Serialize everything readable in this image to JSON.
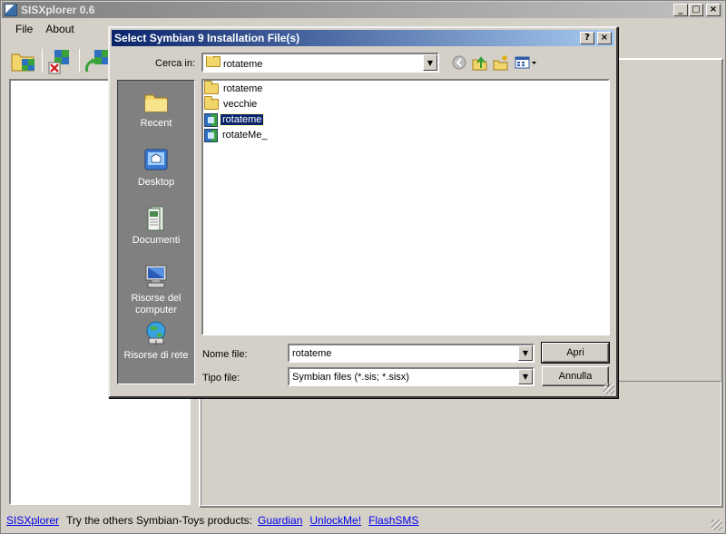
{
  "window": {
    "title": "SISXplorer 0.6",
    "minimize_glyph": "_",
    "maximize_glyph": "□",
    "close_glyph": "×"
  },
  "menu": {
    "items": [
      {
        "label": "File"
      },
      {
        "label": "About"
      }
    ]
  },
  "toolbar": {
    "buttons": [
      {
        "icon": "open-sis-icon"
      },
      {
        "icon": "remove-package-icon"
      },
      {
        "icon": "install-package-icon"
      }
    ]
  },
  "statusbar": {
    "app_link": "SISXplorer",
    "text": "Try the others Symbian-Toys products:",
    "links": [
      "Guardian",
      "UnlockMe!",
      "FlashSMS"
    ]
  },
  "dialog": {
    "title": "Select Symbian 9 Installation File(s)",
    "help_glyph": "?",
    "close_glyph": "×",
    "look_in_label": "Cerca in:",
    "look_in_value": "rotateme",
    "places": [
      {
        "label": "Recent",
        "icon": "recent-folder-icon"
      },
      {
        "label": "Desktop",
        "icon": "desktop-icon"
      },
      {
        "label": "Documenti",
        "icon": "documents-icon"
      },
      {
        "label": "Risorse del computer",
        "icon": "my-computer-icon"
      },
      {
        "label": "Risorse di rete",
        "icon": "network-places-icon"
      }
    ],
    "files": [
      {
        "name": "rotateme",
        "type": "folder"
      },
      {
        "name": "vecchie",
        "type": "folder"
      },
      {
        "name": "rotateme",
        "type": "sis",
        "selected": true
      },
      {
        "name": "rotateMe_",
        "type": "sis"
      }
    ],
    "filename_label": "Nome file:",
    "filename_value": "rotateme",
    "filetype_label": "Tipo file:",
    "filetype_value": "Symbian files (*.sis; *.sisx)",
    "open_button": "Apri",
    "cancel_button": "Annulla"
  }
}
